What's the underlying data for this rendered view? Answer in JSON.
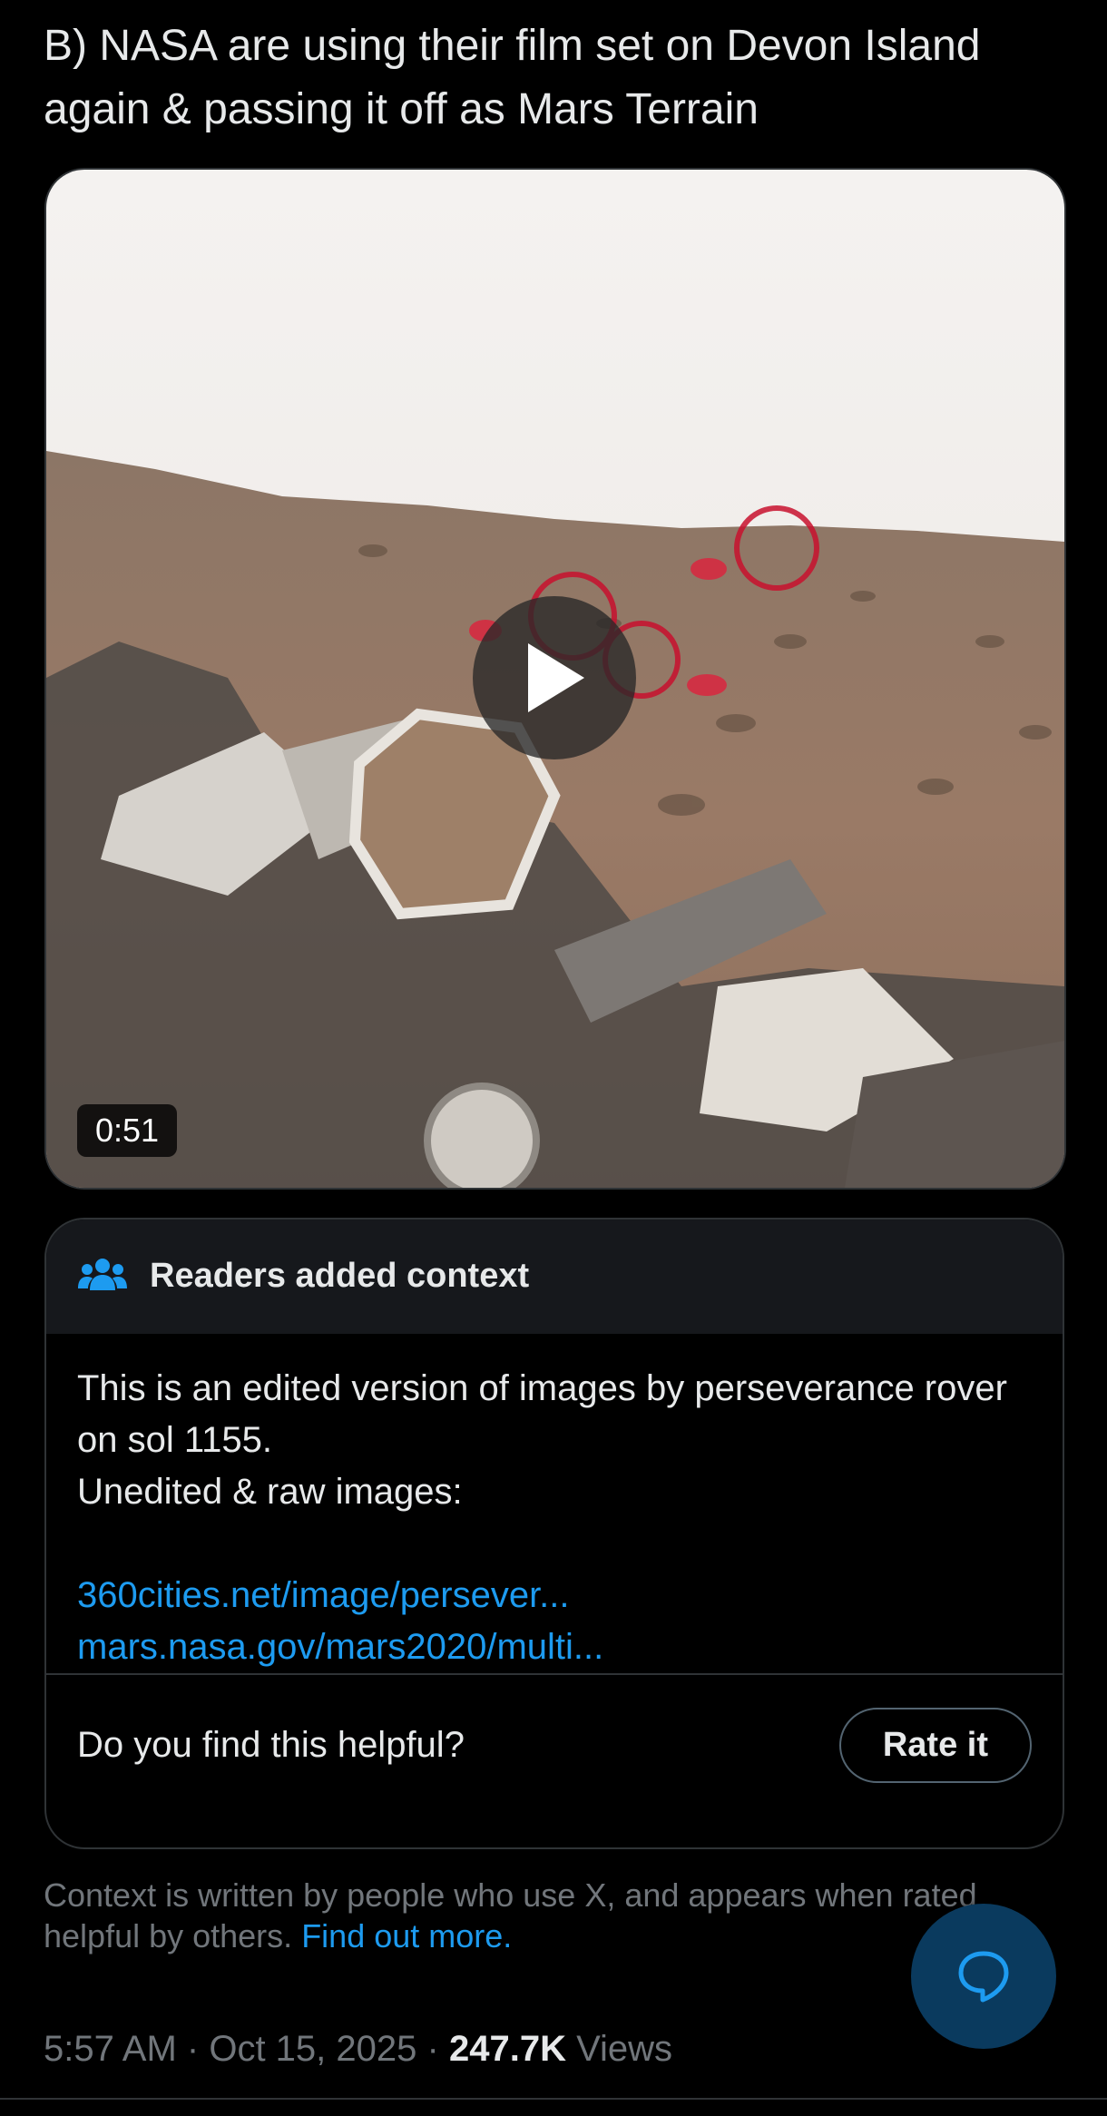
{
  "tweet": {
    "text": "B) NASA are using their film set on Devon Island\nagain & passing it off as Mars Terrain"
  },
  "media": {
    "type": "video",
    "duration": "0:51",
    "play_icon": "play-icon"
  },
  "context": {
    "icon": "people-icon",
    "title": "Readers added context",
    "body_line_1": "This is an edited version of images by perseverance rover on sol 1155.",
    "body_line_2": "Unedited & raw images:",
    "links": [
      "360cities.net/image/persever...",
      "mars.nasa.gov/mars2020/multi..."
    ],
    "question": "Do you find this helpful?",
    "rate_label": "Rate it"
  },
  "note": {
    "text": "Context is written by people who use X, and appears when rated helpful by others.",
    "link": "Find out more."
  },
  "fab": {
    "icon": "chat-bubble-icon"
  },
  "meta": {
    "time": "5:57 AM",
    "date": "Oct 15, 2025",
    "separator": "·",
    "views_count": "247.7K",
    "views_label": "Views"
  },
  "colors": {
    "background": "#000000",
    "text": "#e7e9ea",
    "muted": "#71767b",
    "link": "#1d9bf0",
    "border": "#2f3336"
  }
}
